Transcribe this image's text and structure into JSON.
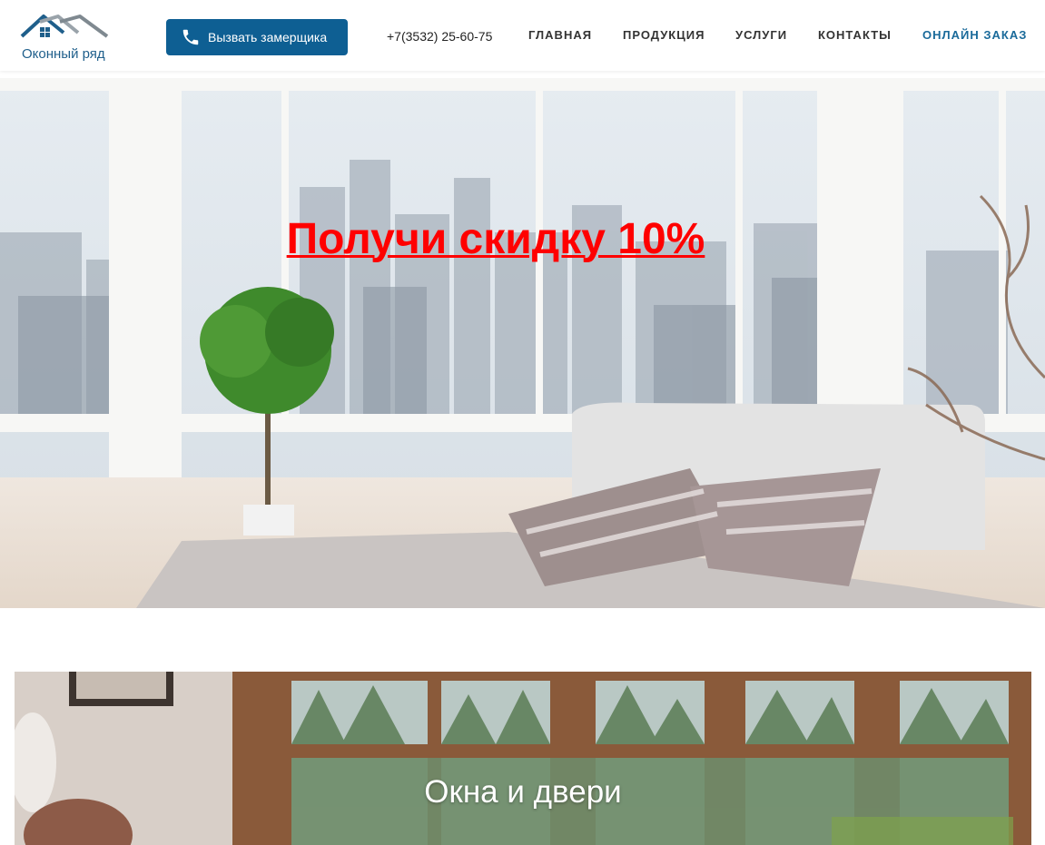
{
  "header": {
    "logo_text": "Оконный ряд",
    "call_button_label": "Вызвать замерщика",
    "phone": "+7(3532) 25-60-75",
    "nav": [
      {
        "label": "ГЛАВНАЯ"
      },
      {
        "label": "ПРОДУКЦИЯ"
      },
      {
        "label": "УСЛУГИ"
      },
      {
        "label": "КОНТАКТЫ"
      },
      {
        "label": "ОНЛАЙН ЗАКАЗ",
        "active": true
      }
    ]
  },
  "hero": {
    "title": "Получи скидку 10%"
  },
  "category": {
    "title": "Окна и двери"
  },
  "colors": {
    "brand": "#0e5f93",
    "active_nav": "#1a6a9a",
    "promo": "#ff0000"
  },
  "icons": {
    "call_button": "phone-icon",
    "logo": "house-roof-icon"
  }
}
